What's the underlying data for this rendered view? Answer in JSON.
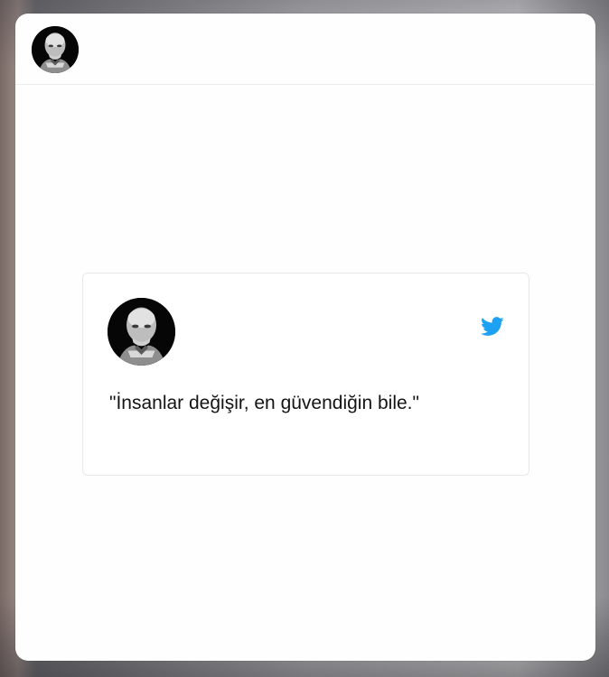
{
  "header": {
    "avatar_icon": "portrait-avatar-icon"
  },
  "tweet": {
    "avatar_icon": "portrait-avatar-icon",
    "brand_icon": "twitter-bird-icon",
    "brand_color": "#1DA1F2",
    "text": "\"İnsanlar değişir, en güvendiğin bile.\""
  }
}
